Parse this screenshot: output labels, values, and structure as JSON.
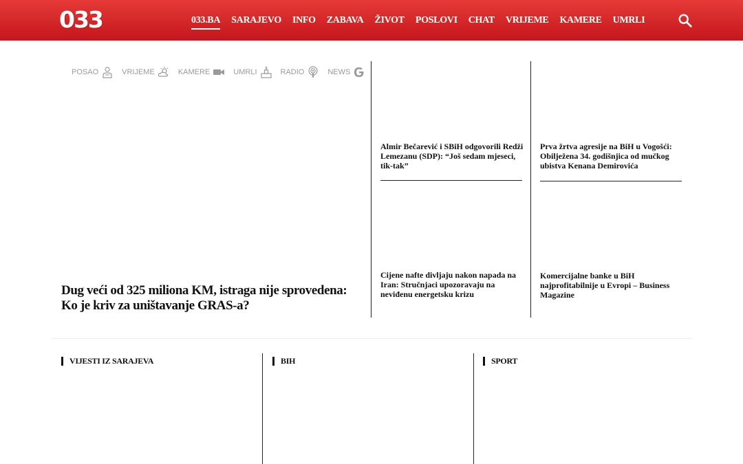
{
  "header": {
    "logo": "033",
    "nav": [
      "033.BA",
      "SARAJEVO",
      "INFO",
      "ZABAVA",
      "ŽIVOT",
      "POSLOVI",
      "CHAT",
      "VRIJEME",
      "KAMERE",
      "UMRLI"
    ],
    "active": "033.BA",
    "search_icon": "search-icon"
  },
  "quicklinks": [
    {
      "label": "POSAO",
      "icon": "worker-icon"
    },
    {
      "label": "VRIJEME",
      "icon": "weather-icon"
    },
    {
      "label": "KAMERE",
      "icon": "camera-icon"
    },
    {
      "label": "UMRLI",
      "icon": "candle-icon"
    },
    {
      "label": "RADIO",
      "icon": "podcast-icon"
    },
    {
      "label": "NEWS",
      "icon": "google-icon"
    }
  ],
  "lead": {
    "title": "Dug veći od 325 miliona KM, istraga nije sprovedena: Ko je kriv za uništavanje GRAS-a?"
  },
  "side": [
    {
      "title": "Almir Bečarević i SBiH odgovorili Redži Lemezanu (SDP): “Još sedam mjeseci, tik-tak”"
    },
    {
      "title": "Prva žrtva agresije na BiH u Vogošći: Obilježena 34. godišnjica od mučkog ubistva Kenana Demirovića"
    },
    {
      "title": "Cijene nafte divljaju nakon napada na Iran: Stručnjaci upozoravaju na neviđenu energetsku krizu"
    },
    {
      "title": "Komercijalne banke u BiH najprofitabilnije u Evropi – Business Magazine"
    }
  ],
  "sections": [
    "VIJESTI IZ SARAJEVA",
    "BIH",
    "SPORT"
  ],
  "colors": {
    "brand": "#d3201f",
    "brand_dark": "#c4161c",
    "muted": "#9a9a9a"
  }
}
